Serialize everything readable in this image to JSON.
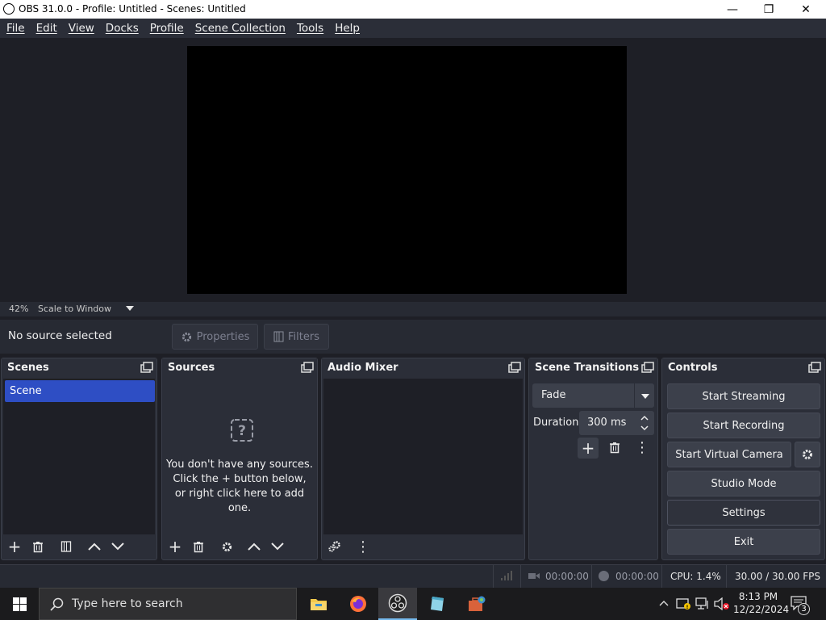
{
  "window": {
    "title": "OBS 31.0.0 - Profile: Untitled - Scenes: Untitled"
  },
  "menu": [
    "File",
    "Edit",
    "View",
    "Docks",
    "Profile",
    "Scene Collection",
    "Tools",
    "Help"
  ],
  "preview": {
    "zoom": "42%",
    "scale_mode": "Scale to Window"
  },
  "context": {
    "no_source": "No source selected",
    "properties": "Properties",
    "filters": "Filters"
  },
  "docks": {
    "scenes": {
      "title": "Scenes",
      "items": [
        "Scene"
      ],
      "selected_index": 0
    },
    "sources": {
      "title": "Sources",
      "empty_line1": "You don't have any sources.",
      "empty_line2": "Click the + button below,",
      "empty_line3": "or right click here to add one."
    },
    "audio": {
      "title": "Audio Mixer"
    },
    "transitions": {
      "title": "Scene Transitions",
      "selected": "Fade",
      "duration_label": "Duration",
      "duration_value": "300 ms"
    },
    "controls": {
      "title": "Controls",
      "start_streaming": "Start Streaming",
      "start_recording": "Start Recording",
      "start_virtual_camera": "Start Virtual Camera",
      "studio_mode": "Studio Mode",
      "settings": "Settings",
      "exit": "Exit"
    }
  },
  "status": {
    "stream_time": "00:00:00",
    "rec_time": "00:00:00",
    "cpu": "CPU: 1.4%",
    "fps": "30.00 / 30.00 FPS"
  },
  "taskbar": {
    "search_placeholder": "Type here to search",
    "time": "8:13 PM",
    "date": "12/22/2024",
    "notification_count": "3"
  },
  "colors": {
    "accent": "#2e4ec4",
    "panel": "#2b2e38",
    "background": "#1e1f26"
  }
}
